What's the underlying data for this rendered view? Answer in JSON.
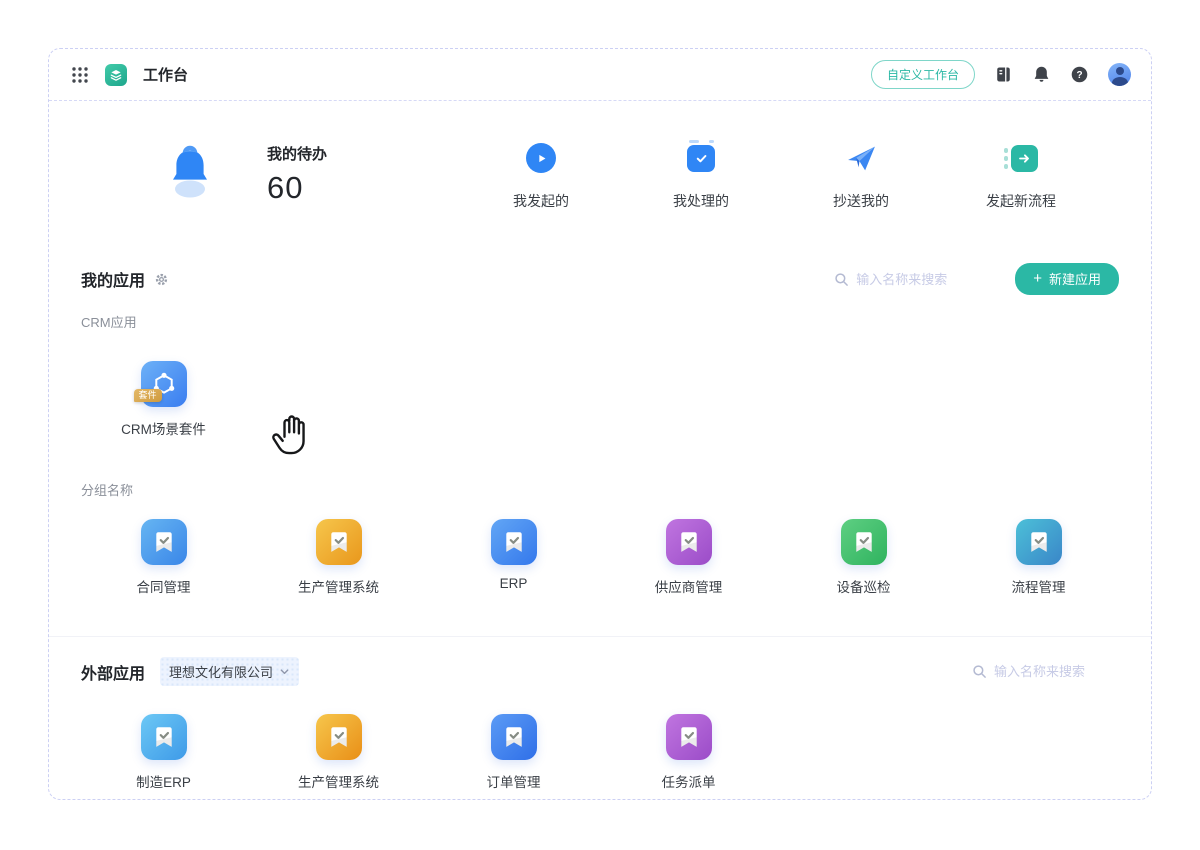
{
  "cursor": {
    "shape": "open-hand"
  },
  "topbar": {
    "app_name": "工作台",
    "customize_button": "自定义工作台",
    "help_glyph": "?",
    "icons": {
      "grid": "app-grid-icon",
      "logo": "workbench-logo",
      "book": "manual-book-icon",
      "bell": "notification-bell-icon",
      "help": "help-icon",
      "avatar": "user-avatar"
    }
  },
  "hero": {
    "todo_label": "我的待办",
    "todo_count": "60",
    "shortcuts": [
      {
        "label": "我发起的",
        "icon": "play-circle-icon",
        "color": "#2f86f5"
      },
      {
        "label": "我处理的",
        "icon": "checkbox-check-icon",
        "color": "#2f86f5"
      },
      {
        "label": "抄送我的",
        "icon": "paper-plane-icon",
        "color": "#3b87f2"
      },
      {
        "label": "发起新流程",
        "icon": "start-flow-icon",
        "color": "#2bb8a5"
      }
    ]
  },
  "my_apps": {
    "title": "我的应用",
    "gear_icon": "settings-gear-icon",
    "search_placeholder": "输入名称来搜索",
    "new_app_plus": "+",
    "new_app_button": "新建应用",
    "accent_color": "#2bb8a5",
    "badge_color": "#d8a554",
    "groups": [
      {
        "name": "CRM应用",
        "apps": [
          {
            "label": "CRM场景套件",
            "badge": "套件",
            "icon": "hexagon-network-icon",
            "colors": [
              "#6db1f7",
              "#3a7df0"
            ]
          }
        ]
      },
      {
        "name": "分组名称",
        "apps": [
          {
            "label": "合同管理",
            "icon": "bookmark-check-icon",
            "colors": [
              "#66b5f2",
              "#3a86e8"
            ]
          },
          {
            "label": "生产管理系统",
            "icon": "bookmark-check-icon",
            "colors": [
              "#f6c64c",
              "#e9971c"
            ]
          },
          {
            "label": "ERP",
            "icon": "bookmark-check-icon",
            "colors": [
              "#62a6f5",
              "#3478ec"
            ]
          },
          {
            "label": "供应商管理",
            "icon": "bookmark-check-icon",
            "colors": [
              "#c075e0",
              "#9b4cc8"
            ]
          },
          {
            "label": "设备巡检",
            "icon": "bookmark-check-icon",
            "colors": [
              "#5ecf82",
              "#2fb35f"
            ]
          },
          {
            "label": "流程管理",
            "icon": "bookmark-check-icon",
            "colors": [
              "#4cc0d8",
              "#3a86c8"
            ]
          }
        ]
      }
    ]
  },
  "external_apps": {
    "title": "外部应用",
    "company_selector": "理想文化有限公司",
    "chevron_icon": "chevron-down-icon",
    "search_placeholder": "输入名称来搜索",
    "apps": [
      {
        "label": "制造ERP",
        "icon": "bookmark-check-icon",
        "colors": [
          "#6cc8f5",
          "#3e9ae8"
        ]
      },
      {
        "label": "生产管理系统",
        "icon": "bookmark-check-icon",
        "colors": [
          "#f6c64c",
          "#e98f17"
        ]
      },
      {
        "label": "订单管理",
        "icon": "bookmark-check-icon",
        "colors": [
          "#5b9bf5",
          "#2f6fe8"
        ]
      },
      {
        "label": "任务派单",
        "icon": "bookmark-check-icon",
        "colors": [
          "#c075e0",
          "#9b4cc8"
        ]
      }
    ]
  }
}
